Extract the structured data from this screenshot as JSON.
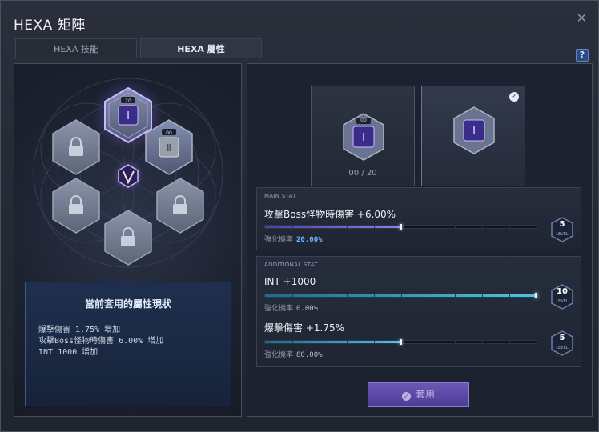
{
  "window": {
    "title": "HEXA 矩陣"
  },
  "tabs": [
    {
      "label": "HEXA 技能",
      "active": false
    },
    {
      "label": "HEXA 屬性",
      "active": true
    }
  ],
  "matrix": {
    "slots": [
      {
        "id": "top",
        "state": "unlocked",
        "icon": "hexa-stat-core-icon",
        "level": "20"
      },
      {
        "id": "upper-right",
        "state": "unlocked",
        "icon": "hexa-stat-core-ii-icon",
        "level": "00"
      },
      {
        "id": "upper-left",
        "state": "locked",
        "icon": "lock-icon"
      },
      {
        "id": "lower-left",
        "state": "locked",
        "icon": "lock-icon"
      },
      {
        "id": "lower-right",
        "state": "locked",
        "icon": "lock-icon"
      },
      {
        "id": "bottom",
        "state": "locked",
        "icon": "lock-icon"
      }
    ],
    "center_icon": "hexa-emblem-icon"
  },
  "status": {
    "title": "當前套用的屬性現狀",
    "lines": [
      "爆擊傷害 1.75% 增加",
      "攻擊Boss怪物時傷害 6.00% 增加",
      "INT 1000 增加"
    ]
  },
  "cards": [
    {
      "level": "00",
      "count": "00",
      "separator": "/",
      "max": "20",
      "selected": false
    },
    {
      "selected": true
    }
  ],
  "main_stat": {
    "header": "MAIN STAT",
    "name": "攻擊Boss怪物時傷害 +6.00%",
    "rate_label": "強化機率",
    "rate_value": "20.00%",
    "level": "5",
    "level_label": "LEVEL",
    "progress": 0.5
  },
  "additional_stat": {
    "header": "ADDITIONAL STAT",
    "items": [
      {
        "name": "INT +1000",
        "rate_label": "強化機率",
        "rate_value": "0.00%",
        "level": "10",
        "level_label": "LEVEL",
        "progress": 1.0
      },
      {
        "name": "爆擊傷害 +1.75%",
        "rate_label": "強化機率",
        "rate_value": "80.00%",
        "level": "5",
        "level_label": "LEVEL",
        "progress": 0.5
      }
    ]
  },
  "apply_button": {
    "label": "套用"
  },
  "colors": {
    "accent_purple": "#8e7cf0",
    "accent_teal": "#48c8e0",
    "button_purple": "#5a4aa6"
  }
}
